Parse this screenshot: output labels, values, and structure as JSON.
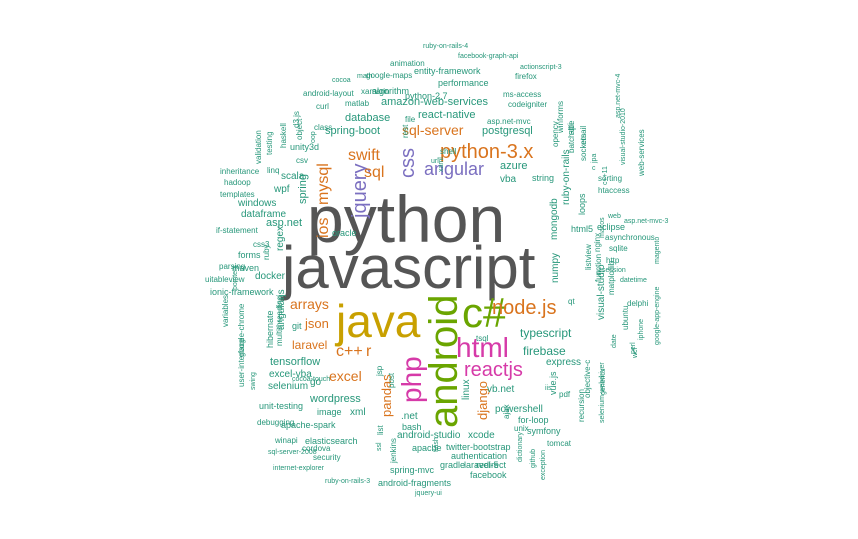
{
  "colors": {
    "gray": "#555555",
    "gold": "#c8a000",
    "green": "#6aa500",
    "magenta": "#d63aa8",
    "orange": "#d9741e",
    "purple": "#7b6fc0",
    "teal": "#27977a",
    "darkteal": "#2b7a65"
  },
  "words": [
    {
      "text": "python",
      "color": "gray"
    },
    {
      "text": "javascript",
      "color": "gray"
    },
    {
      "text": "java",
      "color": "gold"
    },
    {
      "text": "c#",
      "color": "green"
    },
    {
      "text": "android",
      "color": "green"
    },
    {
      "text": "php",
      "color": "magenta"
    },
    {
      "text": "html",
      "color": "magenta"
    },
    {
      "text": "node.js",
      "color": "orange"
    },
    {
      "text": "reactjs",
      "color": "magenta"
    },
    {
      "text": "python-3.x",
      "color": "orange"
    },
    {
      "text": "angular",
      "color": "purple"
    },
    {
      "text": "css",
      "color": "purple"
    },
    {
      "text": "jquery",
      "color": "purple"
    },
    {
      "text": "ios",
      "color": "orange"
    },
    {
      "text": "mysql",
      "color": "orange"
    },
    {
      "text": "swift",
      "color": "orange"
    },
    {
      "text": "sql",
      "color": "orange"
    },
    {
      "text": "c++",
      "color": "orange"
    },
    {
      "text": "r",
      "color": "orange"
    },
    {
      "text": "arrays",
      "color": "orange"
    },
    {
      "text": "json",
      "color": "orange"
    },
    {
      "text": "excel",
      "color": "orange"
    },
    {
      "text": "laravel",
      "color": "orange"
    },
    {
      "text": "pandas",
      "color": "orange"
    },
    {
      "text": "django",
      "color": "orange"
    },
    {
      "text": "sql-server",
      "color": "orange"
    },
    {
      "text": "typescript",
      "color": "teal"
    },
    {
      "text": "firebase",
      "color": "teal"
    },
    {
      "text": "amazon-web-services",
      "color": "teal"
    },
    {
      "text": "react-native",
      "color": "teal"
    },
    {
      "text": "database",
      "color": "teal"
    },
    {
      "text": "spring-boot",
      "color": "teal"
    },
    {
      "text": "postgresql",
      "color": "teal"
    },
    {
      "text": "azure",
      "color": "teal"
    },
    {
      "text": "vba",
      "color": "teal"
    },
    {
      "text": "string",
      "color": "teal"
    },
    {
      "text": "ruby-on-rails",
      "color": "teal"
    },
    {
      "text": "mongodb",
      "color": "teal"
    },
    {
      "text": "numpy",
      "color": "teal"
    },
    {
      "text": "html5",
      "color": "teal"
    },
    {
      "text": "loops",
      "color": "teal"
    },
    {
      "text": "visual-studio",
      "color": "teal"
    },
    {
      "text": "linux",
      "color": "teal"
    },
    {
      "text": "express",
      "color": "teal"
    },
    {
      "text": "vb.net",
      "color": "teal"
    },
    {
      "text": "powershell",
      "color": "teal"
    },
    {
      "text": "for-loop",
      "color": "teal"
    },
    {
      "text": "symfony",
      "color": "teal"
    },
    {
      "text": "xcode",
      "color": "teal"
    },
    {
      "text": "android-studio",
      "color": "teal"
    },
    {
      "text": "twitter-bootstrap",
      "color": "teal"
    },
    {
      "text": "authentication",
      "color": "teal"
    },
    {
      "text": "laravel-5",
      "color": "teal"
    },
    {
      "text": "spring-mvc",
      "color": "teal"
    },
    {
      "text": "gradle",
      "color": "teal"
    },
    {
      "text": "redirect",
      "color": "teal"
    },
    {
      "text": "facebook",
      "color": "teal"
    },
    {
      "text": "android-fragments",
      "color": "teal"
    },
    {
      "text": "bash",
      "color": "teal"
    },
    {
      "text": "apache",
      "color": "teal"
    },
    {
      "text": "unix",
      "color": "teal"
    },
    {
      "text": "tomcat",
      "color": "teal"
    },
    {
      "text": "cordova",
      "color": "teal"
    },
    {
      "text": "security",
      "color": "teal"
    },
    {
      "text": "elasticsearch",
      "color": "teal"
    },
    {
      "text": "apache-spark",
      "color": "teal"
    },
    {
      "text": "image",
      "color": "teal"
    },
    {
      "text": "xml",
      "color": "teal"
    },
    {
      "text": "wordpress",
      "color": "teal"
    },
    {
      "text": "selenium",
      "color": "teal"
    },
    {
      "text": "go",
      "color": "teal"
    },
    {
      "text": "excel-vba",
      "color": "teal"
    },
    {
      "text": "tensorflow",
      "color": "teal"
    },
    {
      "text": "unit-testing",
      "color": "teal"
    },
    {
      "text": "debugging",
      "color": "teal"
    },
    {
      "text": "winapi",
      "color": "teal"
    },
    {
      "text": ".net",
      "color": "teal"
    },
    {
      "text": "angularjs",
      "color": "teal"
    },
    {
      "text": "git",
      "color": "teal"
    },
    {
      "text": "hibernate",
      "color": "teal"
    },
    {
      "text": "multithreading",
      "color": "teal"
    },
    {
      "text": "google-chrome",
      "color": "teal"
    },
    {
      "text": "user-interface",
      "color": "teal"
    },
    {
      "text": "variables",
      "color": "teal"
    },
    {
      "text": "ionic-framework",
      "color": "teal"
    },
    {
      "text": "docker",
      "color": "teal"
    },
    {
      "text": "maven",
      "color": "teal"
    },
    {
      "text": "forms",
      "color": "teal"
    },
    {
      "text": "uitableview",
      "color": "teal"
    },
    {
      "text": "parsing",
      "color": "teal"
    },
    {
      "text": "if-statement",
      "color": "teal"
    },
    {
      "text": "css3",
      "color": "teal"
    },
    {
      "text": "regex",
      "color": "teal"
    },
    {
      "text": "oracle",
      "color": "teal"
    },
    {
      "text": "asp.net",
      "color": "teal"
    },
    {
      "text": "dataframe",
      "color": "teal"
    },
    {
      "text": "windows",
      "color": "teal"
    },
    {
      "text": "wpf",
      "color": "teal"
    },
    {
      "text": "spring",
      "color": "teal"
    },
    {
      "text": "scala",
      "color": "teal"
    },
    {
      "text": "templates",
      "color": "teal"
    },
    {
      "text": "hadoop",
      "color": "teal"
    },
    {
      "text": "inheritance",
      "color": "teal"
    },
    {
      "text": "linq",
      "color": "teal"
    },
    {
      "text": "csv",
      "color": "teal"
    },
    {
      "text": "unity3d",
      "color": "teal"
    },
    {
      "text": "class",
      "color": "teal"
    },
    {
      "text": "matlab",
      "color": "teal"
    },
    {
      "text": "curl",
      "color": "teal"
    },
    {
      "text": "algorithm",
      "color": "teal"
    },
    {
      "text": "python-2.7",
      "color": "teal"
    },
    {
      "text": "entity-framework",
      "color": "teal"
    },
    {
      "text": "performance",
      "color": "teal"
    },
    {
      "text": "google-maps",
      "color": "teal"
    },
    {
      "text": "animation",
      "color": "teal"
    },
    {
      "text": "android-layout",
      "color": "teal"
    },
    {
      "text": "ruby-on-rails-4",
      "color": "teal"
    },
    {
      "text": "facebook-graph-api",
      "color": "teal"
    },
    {
      "text": "actionscript-3",
      "color": "teal"
    },
    {
      "text": "firefox",
      "color": "teal"
    },
    {
      "text": "ms-access",
      "color": "teal"
    },
    {
      "text": "codeigniter",
      "color": "teal"
    },
    {
      "text": "asp.net-mvc",
      "color": "teal"
    },
    {
      "text": "file",
      "color": "teal"
    },
    {
      "text": "rest",
      "color": "teal"
    },
    {
      "text": "shell",
      "color": "teal"
    },
    {
      "text": "api",
      "color": "teal"
    },
    {
      "text": "batch-file",
      "color": "teal"
    },
    {
      "text": "email",
      "color": "teal"
    },
    {
      "text": "sockets",
      "color": "teal"
    },
    {
      "text": "jpa",
      "color": "teal"
    },
    {
      "text": "c",
      "color": "teal"
    },
    {
      "text": "c++11",
      "color": "teal"
    },
    {
      "text": "opencv",
      "color": "teal"
    },
    {
      "text": "winforms",
      "color": "teal"
    },
    {
      "text": "sorting",
      "color": "teal"
    },
    {
      "text": "htaccess",
      "color": "teal"
    },
    {
      "text": "web",
      "color": "teal"
    },
    {
      "text": "asp.net-mvc-3",
      "color": "teal"
    },
    {
      "text": "eclipse",
      "color": "teal"
    },
    {
      "text": "asynchronous",
      "color": "teal"
    },
    {
      "text": "sqlite",
      "color": "teal"
    },
    {
      "text": "http",
      "color": "teal"
    },
    {
      "text": "session",
      "color": "teal"
    },
    {
      "text": "datetime",
      "color": "teal"
    },
    {
      "text": "delphi",
      "color": "teal"
    },
    {
      "text": "matplotlib",
      "color": "teal"
    },
    {
      "text": "function",
      "color": "teal"
    },
    {
      "text": "listview",
      "color": "teal"
    },
    {
      "text": "nginx",
      "color": "teal"
    },
    {
      "text": "macos",
      "color": "teal"
    },
    {
      "text": "qt",
      "color": "teal"
    },
    {
      "text": "ubuntu",
      "color": "teal"
    },
    {
      "text": "iphone",
      "color": "teal"
    },
    {
      "text": "google-app-engine",
      "color": "teal"
    },
    {
      "text": "perl",
      "color": "teal"
    },
    {
      "text": "date",
      "color": "teal"
    },
    {
      "text": "generics",
      "color": "teal"
    },
    {
      "text": "objective-c",
      "color": "teal"
    },
    {
      "text": "recursion",
      "color": "teal"
    },
    {
      "text": "selenium-webdriver",
      "color": "teal"
    },
    {
      "text": "pdf",
      "color": "teal"
    },
    {
      "text": "dictionary",
      "color": "teal"
    },
    {
      "text": "exception",
      "color": "teal"
    },
    {
      "text": "github",
      "color": "teal"
    },
    {
      "text": "ajax",
      "color": "teal"
    },
    {
      "text": "vue.js",
      "color": "teal"
    },
    {
      "text": "tsql",
      "color": "teal"
    },
    {
      "text": "jenkins",
      "color": "teal"
    },
    {
      "text": "jsp",
      "color": "teal"
    },
    {
      "text": "post",
      "color": "teal"
    },
    {
      "text": "list",
      "color": "teal"
    },
    {
      "text": "ssl",
      "color": "teal"
    },
    {
      "text": "swing",
      "color": "teal"
    },
    {
      "text": "ruby",
      "color": "teal"
    },
    {
      "text": "pointers",
      "color": "teal"
    },
    {
      "text": "validation",
      "color": "teal"
    },
    {
      "text": "testing",
      "color": "teal"
    },
    {
      "text": "haskell",
      "color": "teal"
    },
    {
      "text": "d3.js",
      "color": "teal"
    },
    {
      "text": "object",
      "color": "teal"
    },
    {
      "text": "oop",
      "color": "teal"
    },
    {
      "text": "math",
      "color": "teal"
    },
    {
      "text": "xamarin",
      "color": "teal"
    },
    {
      "text": "url",
      "color": "teal"
    },
    {
      "text": "magento",
      "color": "teal"
    },
    {
      "text": "web-services",
      "color": "teal"
    },
    {
      "text": "xaml",
      "color": "teal"
    },
    {
      "text": "cocoa",
      "color": "teal"
    },
    {
      "text": "cocoa-touch",
      "color": "teal"
    },
    {
      "text": "sql-server-2008",
      "color": "teal"
    },
    {
      "text": "internet-explorer",
      "color": "teal"
    },
    {
      "text": "ruby-on-rails-3",
      "color": "teal"
    },
    {
      "text": "jquery-ui",
      "color": "teal"
    },
    {
      "text": "flash",
      "color": "teal"
    },
    {
      "text": "visual-studio-2010",
      "color": "teal"
    },
    {
      "text": "asp.net-mvc-4",
      "color": "teal"
    },
    {
      "text": "wcf",
      "color": "teal"
    },
    {
      "text": "iis",
      "color": "teal"
    }
  ]
}
